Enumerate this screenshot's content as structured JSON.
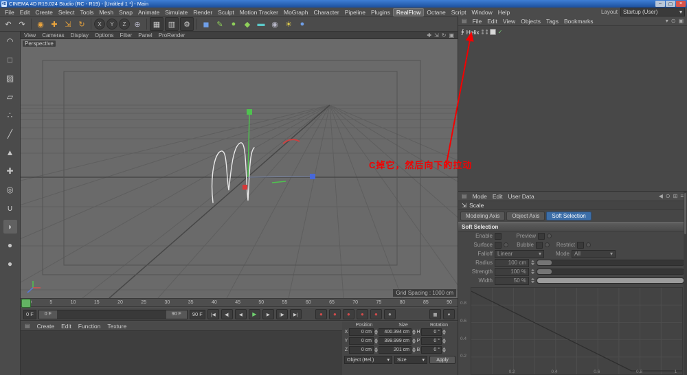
{
  "ui": {
    "dropdown_arrow": "▾",
    "panel_icon": "▤"
  },
  "titlebar": {
    "app_icon": "4D",
    "title": "CINEMA 4D R19.024 Studio (RC - R19) - [Untitled 1 *] - Main",
    "minimize": "–",
    "restore": "▢",
    "close": "×"
  },
  "menubar": {
    "items": [
      "File",
      "Edit",
      "Create",
      "Select",
      "Tools",
      "Mesh",
      "Snap",
      "Animate",
      "Simulate",
      "Render",
      "Sculpt",
      "Motion Tracker",
      "MoGraph",
      "Character",
      "Pipeline",
      "Plugins",
      "RealFlow",
      "Octane",
      "Script",
      "Window",
      "Help"
    ],
    "layout_label": "Layout",
    "layout_value": "Startup (User)"
  },
  "toolbar": {
    "icons": [
      {
        "name": "undo",
        "glyph": "↶"
      },
      {
        "name": "redo",
        "glyph": "↷"
      },
      {
        "name": "live-selection",
        "glyph": "◉"
      },
      {
        "name": "move",
        "glyph": "✚"
      },
      {
        "name": "scale",
        "glyph": "⇲"
      },
      {
        "name": "rotate",
        "glyph": "↻"
      },
      {
        "name": "x-axis-lock",
        "glyph": "X"
      },
      {
        "name": "y-axis-lock",
        "glyph": "Y"
      },
      {
        "name": "z-axis-lock",
        "glyph": "Z"
      },
      {
        "name": "coordinate-system",
        "glyph": "⊕"
      },
      {
        "name": "render-view",
        "glyph": "▦"
      },
      {
        "name": "render-picture-viewer",
        "glyph": "▥"
      },
      {
        "name": "render-settings",
        "glyph": "⚙"
      },
      {
        "name": "primitive-cube",
        "glyph": "◼"
      },
      {
        "name": "pen-spline",
        "glyph": "✎"
      },
      {
        "name": "subdivision-surface",
        "glyph": "●"
      },
      {
        "name": "mograph",
        "glyph": "◆"
      },
      {
        "name": "floor",
        "glyph": "▬"
      },
      {
        "name": "camera",
        "glyph": "◉"
      },
      {
        "name": "light",
        "glyph": "☀"
      },
      {
        "name": "sky",
        "glyph": "●"
      }
    ]
  },
  "left_toolbar": {
    "icons": [
      {
        "name": "make-editable",
        "glyph": "◠"
      },
      {
        "name": "model-mode",
        "glyph": "□"
      },
      {
        "name": "texture-mode",
        "glyph": "▨"
      },
      {
        "name": "workplane-mode",
        "glyph": "▱"
      },
      {
        "name": "points-mode",
        "glyph": "∴"
      },
      {
        "name": "edges-mode",
        "glyph": "╱"
      },
      {
        "name": "polygons-mode",
        "glyph": "▲"
      },
      {
        "name": "enable-axis",
        "glyph": "✚"
      },
      {
        "name": "viewport-solo",
        "glyph": "◎"
      },
      {
        "name": "snap",
        "glyph": "∪"
      },
      {
        "name": "paint-tool",
        "glyph": "◗"
      },
      {
        "name": "content-browser",
        "glyph": "●"
      },
      {
        "name": "coordinates-sphere",
        "glyph": "●"
      }
    ]
  },
  "viewport": {
    "menus": [
      "View",
      "Cameras",
      "Display",
      "Options",
      "Filter",
      "Panel",
      "ProRender"
    ],
    "corner_icons": [
      {
        "name": "pan",
        "glyph": "✚"
      },
      {
        "name": "zoom",
        "glyph": "⇲"
      },
      {
        "name": "orbit",
        "glyph": "↻"
      },
      {
        "name": "toggle-views",
        "glyph": "▣"
      }
    ],
    "camera_label": "Perspective",
    "grid_spacing": "Grid Spacing : 1000 cm"
  },
  "timeline": {
    "ticks": [
      "0",
      "5",
      "10",
      "15",
      "20",
      "25",
      "30",
      "35",
      "40",
      "45",
      "50",
      "55",
      "60",
      "65",
      "70",
      "75",
      "80",
      "85",
      "90"
    ]
  },
  "transport": {
    "current_frame": "0 F",
    "range_start": "0 F",
    "range_end": "90 F",
    "end_frame": "90 F",
    "buttons": [
      {
        "name": "goto-start",
        "glyph": "|◀"
      },
      {
        "name": "prev-key",
        "glyph": "◀|"
      },
      {
        "name": "prev-frame",
        "glyph": "◀"
      },
      {
        "name": "play",
        "glyph": "▶"
      },
      {
        "name": "next-frame",
        "glyph": "▶"
      },
      {
        "name": "next-key",
        "glyph": "|▶"
      },
      {
        "name": "goto-end",
        "glyph": "▶|"
      }
    ],
    "record_buttons": [
      {
        "name": "record-keyframe",
        "glyph": "●"
      },
      {
        "name": "autokey",
        "glyph": "●"
      },
      {
        "name": "record-position",
        "glyph": "●"
      },
      {
        "name": "record-scale",
        "glyph": "●"
      },
      {
        "name": "record-rotation",
        "glyph": "●"
      },
      {
        "name": "record-parameter",
        "glyph": "●"
      }
    ],
    "right_icons": [
      {
        "name": "keyframe-selection",
        "glyph": "▦"
      },
      {
        "name": "timeline-options",
        "glyph": "▾"
      }
    ]
  },
  "material_manager": {
    "menus": [
      "Create",
      "Edit",
      "Function",
      "Texture"
    ]
  },
  "coordinates": {
    "headers": [
      "Position",
      "Size",
      "Rotation"
    ],
    "rows": [
      {
        "pos_axis": "X",
        "pos": "0 cm",
        "size": "400.394 cm",
        "rot_axis": "H",
        "rot": "0 °"
      },
      {
        "pos_axis": "Y",
        "pos": "0 cm",
        "size": "399.999 cm",
        "rot_axis": "P",
        "rot": "0 °"
      },
      {
        "pos_axis": "Z",
        "pos": "0 cm",
        "size": "201 cm",
        "rot_axis": "B",
        "rot": "0 °"
      }
    ],
    "object_mode": "Object (Rel.)",
    "size_mode": "Size",
    "apply_label": "Apply"
  },
  "object_manager": {
    "menus": [
      "File",
      "Edit",
      "View",
      "Objects",
      "Tags",
      "Bookmarks"
    ],
    "right_icons": [
      {
        "name": "filter",
        "glyph": "▾"
      },
      {
        "name": "search",
        "glyph": "⊙"
      },
      {
        "name": "lock",
        "glyph": "▣"
      }
    ],
    "objects": [
      {
        "name": "Helix",
        "icon": "∮",
        "check": "✓"
      }
    ]
  },
  "attribute_manager": {
    "menus": [
      "Mode",
      "Edit",
      "User Data"
    ],
    "right_icons": [
      {
        "name": "history-back",
        "glyph": "◀"
      },
      {
        "name": "search",
        "glyph": "⊙"
      },
      {
        "name": "layout-grid",
        "glyph": "⊞"
      },
      {
        "name": "panel-menu",
        "glyph": "≡"
      }
    ],
    "tool_icon": "⇲",
    "tool_name": "Scale",
    "tabs": [
      "Modeling Axis",
      "Object Axis",
      "Soft Selection"
    ],
    "section_title": "Soft Selection",
    "params": {
      "enable_label": "Enable",
      "preview_label": "Preview",
      "surface_label": "Surface",
      "bubble_label": "Bubble",
      "restrict_label": "Restrict",
      "falloff_label": "Falloff",
      "falloff_value": "Linear",
      "mode_label": "Mode",
      "mode_value": "All",
      "radius_label": "Radius",
      "radius_value": "100 cm",
      "strength_label": "Strength",
      "strength_value": "100 %",
      "width_label": "Width",
      "width_value": "50 %"
    },
    "graph": {
      "y_labels": [
        "0.8",
        "0.6",
        "0.4",
        "0.2"
      ],
      "x_labels": [
        "0.2",
        "0.4",
        "0.6",
        "0.8",
        "1"
      ]
    }
  },
  "annotation": {
    "text": "C掉它，然后向下的拉动",
    "color": "#f40000"
  }
}
